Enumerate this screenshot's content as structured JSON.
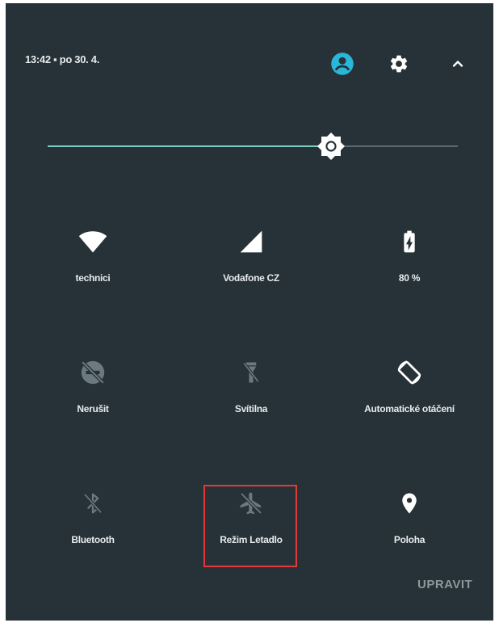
{
  "header": {
    "datetime": "13:42  ▪  po 30. 4.",
    "icons": [
      "account-icon",
      "settings-icon",
      "chevron-up-icon"
    ]
  },
  "brightness": {
    "level": 0.69
  },
  "tiles": [
    {
      "label": "technici",
      "icon": "wifi-icon",
      "active": true
    },
    {
      "label": "Vodafone CZ",
      "icon": "cell-signal-icon",
      "active": true
    },
    {
      "label": "80 %",
      "icon": "battery-charging-icon",
      "active": true
    },
    {
      "label": "Nerušit",
      "icon": "do-not-disturb-off-icon",
      "active": false
    },
    {
      "label": "Svítilna",
      "icon": "flashlight-off-icon",
      "active": false
    },
    {
      "label": "Automatické otáčení",
      "icon": "auto-rotate-icon",
      "active": true
    },
    {
      "label": "Bluetooth",
      "icon": "bluetooth-off-icon",
      "active": false
    },
    {
      "label": "Režim Letadlo",
      "icon": "airplane-off-icon",
      "active": false
    },
    {
      "label": "Poloha",
      "icon": "location-icon",
      "active": true
    }
  ],
  "footer": {
    "edit_label": "UPRAVIT"
  },
  "colors": {
    "panel_bg": "#263238",
    "accent": "#80cbc4",
    "avatar": "#29b6d8",
    "highlight": "#e53935"
  }
}
